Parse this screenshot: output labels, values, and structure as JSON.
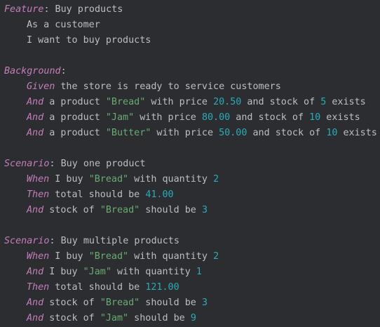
{
  "editor": {
    "colors": {
      "background": "#2b2d30",
      "text": "#bcbec4",
      "keyword": "#c77dbb",
      "string": "#6aab73",
      "number": "#2aacb8"
    },
    "lines": [
      {
        "indent": false,
        "tokens": [
          {
            "t": "kw",
            "v": "Feature"
          },
          {
            "t": "txt",
            "v": ": Buy products"
          }
        ]
      },
      {
        "indent": true,
        "tokens": [
          {
            "t": "txt",
            "v": "As a customer"
          }
        ]
      },
      {
        "indent": true,
        "tokens": [
          {
            "t": "txt",
            "v": "I want to buy products"
          }
        ]
      },
      {
        "indent": false,
        "tokens": []
      },
      {
        "indent": false,
        "tokens": [
          {
            "t": "kw",
            "v": "Background"
          },
          {
            "t": "txt",
            "v": ":"
          }
        ]
      },
      {
        "indent": true,
        "tokens": [
          {
            "t": "kw",
            "v": "Given"
          },
          {
            "t": "txt",
            "v": " the store is ready to service customers"
          }
        ]
      },
      {
        "indent": true,
        "tokens": [
          {
            "t": "kw",
            "v": "And"
          },
          {
            "t": "txt",
            "v": " a product "
          },
          {
            "t": "str",
            "v": "\"Bread\""
          },
          {
            "t": "txt",
            "v": " with price "
          },
          {
            "t": "num",
            "v": "20.50"
          },
          {
            "t": "txt",
            "v": " and stock of "
          },
          {
            "t": "num",
            "v": "5"
          },
          {
            "t": "txt",
            "v": " exists"
          }
        ]
      },
      {
        "indent": true,
        "tokens": [
          {
            "t": "kw",
            "v": "And"
          },
          {
            "t": "txt",
            "v": " a product "
          },
          {
            "t": "str",
            "v": "\"Jam\""
          },
          {
            "t": "txt",
            "v": " with price "
          },
          {
            "t": "num",
            "v": "80.00"
          },
          {
            "t": "txt",
            "v": " and stock of "
          },
          {
            "t": "num",
            "v": "10"
          },
          {
            "t": "txt",
            "v": " exists"
          }
        ]
      },
      {
        "indent": true,
        "tokens": [
          {
            "t": "kw",
            "v": "And"
          },
          {
            "t": "txt",
            "v": " a product "
          },
          {
            "t": "str",
            "v": "\"Butter\""
          },
          {
            "t": "txt",
            "v": " with price "
          },
          {
            "t": "num",
            "v": "50.00"
          },
          {
            "t": "txt",
            "v": " and stock of "
          },
          {
            "t": "num",
            "v": "10"
          },
          {
            "t": "txt",
            "v": " exists"
          }
        ]
      },
      {
        "indent": false,
        "tokens": []
      },
      {
        "indent": false,
        "tokens": [
          {
            "t": "kw",
            "v": "Scenario"
          },
          {
            "t": "txt",
            "v": ": Buy one product"
          }
        ]
      },
      {
        "indent": true,
        "tokens": [
          {
            "t": "kw",
            "v": "When"
          },
          {
            "t": "txt",
            "v": " I buy "
          },
          {
            "t": "str",
            "v": "\"Bread\""
          },
          {
            "t": "txt",
            "v": " with quantity "
          },
          {
            "t": "num",
            "v": "2"
          }
        ]
      },
      {
        "indent": true,
        "tokens": [
          {
            "t": "kw",
            "v": "Then"
          },
          {
            "t": "txt",
            "v": " total should be "
          },
          {
            "t": "num",
            "v": "41.00"
          }
        ]
      },
      {
        "indent": true,
        "tokens": [
          {
            "t": "kw",
            "v": "And"
          },
          {
            "t": "txt",
            "v": " stock of "
          },
          {
            "t": "str",
            "v": "\"Bread\""
          },
          {
            "t": "txt",
            "v": " should be "
          },
          {
            "t": "num",
            "v": "3"
          }
        ]
      },
      {
        "indent": false,
        "tokens": []
      },
      {
        "indent": false,
        "tokens": [
          {
            "t": "kw",
            "v": "Scenario"
          },
          {
            "t": "txt",
            "v": ": Buy multiple products"
          }
        ]
      },
      {
        "indent": true,
        "tokens": [
          {
            "t": "kw",
            "v": "When"
          },
          {
            "t": "txt",
            "v": " I buy "
          },
          {
            "t": "str",
            "v": "\"Bread\""
          },
          {
            "t": "txt",
            "v": " with quantity "
          },
          {
            "t": "num",
            "v": "2"
          }
        ]
      },
      {
        "indent": true,
        "tokens": [
          {
            "t": "kw",
            "v": "And"
          },
          {
            "t": "txt",
            "v": " I buy "
          },
          {
            "t": "str",
            "v": "\"Jam\""
          },
          {
            "t": "txt",
            "v": " with quantity "
          },
          {
            "t": "num",
            "v": "1"
          }
        ]
      },
      {
        "indent": true,
        "tokens": [
          {
            "t": "kw",
            "v": "Then"
          },
          {
            "t": "txt",
            "v": " total should be "
          },
          {
            "t": "num",
            "v": "121.00"
          }
        ]
      },
      {
        "indent": true,
        "tokens": [
          {
            "t": "kw",
            "v": "And"
          },
          {
            "t": "txt",
            "v": " stock of "
          },
          {
            "t": "str",
            "v": "\"Bread\""
          },
          {
            "t": "txt",
            "v": " should be "
          },
          {
            "t": "num",
            "v": "3"
          }
        ]
      },
      {
        "indent": true,
        "tokens": [
          {
            "t": "kw",
            "v": "And"
          },
          {
            "t": "txt",
            "v": " stock of "
          },
          {
            "t": "str",
            "v": "\"Jam\""
          },
          {
            "t": "txt",
            "v": " should be "
          },
          {
            "t": "num",
            "v": "9"
          }
        ]
      }
    ]
  }
}
